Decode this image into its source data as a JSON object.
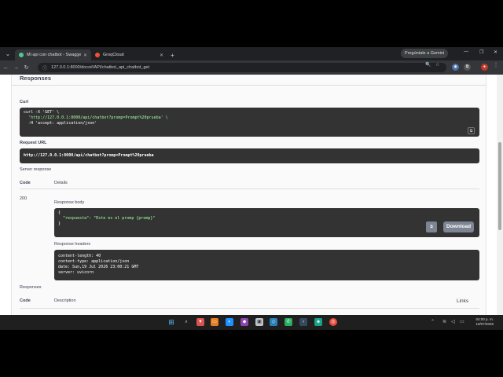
{
  "browser": {
    "tabs": [
      {
        "label": "Mi api con chatbot - Swagger",
        "favicon_color": "#49cc90",
        "active": true
      },
      {
        "label": "GroqCloud",
        "favicon_color": "#f55036",
        "active": false
      }
    ],
    "new_tab": "+",
    "gemini_button": "Pregúntale a Gemini",
    "url": "127.0.0.1:8000/docs#/API/chatbot_api_chatbot_get"
  },
  "page": {
    "responses_heading_top": "Responses",
    "curl_label": "Curl",
    "curl_lines": [
      "curl -X 'GET' \\",
      "  'http://127.0.0.1:8000/api/chatbot?promp=Prompt%20prueba' \\",
      "  -H 'accept: application/json'"
    ],
    "request_url_label": "Request URL",
    "request_url": "http://127.0.0.1:8000/api/chatbot?promp=Prompt%20prueba",
    "server_response_label": "Server response",
    "code_header": "Code",
    "details_header": "Details",
    "status_code": "200",
    "response_body_label": "Response body",
    "response_body_lines": [
      "{",
      "  \"respuesta\": \"Este es el promp {promp}\"",
      "}"
    ],
    "download_button": "Download",
    "response_headers_label": "Response headers",
    "response_headers_lines": [
      "content-length: 40",
      "content-type: application/json",
      "date: Sun,19 Jul 2026 23:00:21 GMT",
      "server: uvicorn"
    ],
    "responses_heading_bottom": "Responses",
    "code_header_2": "Code",
    "description_header": "Description",
    "links_header": "Links"
  },
  "taskbar": {
    "time": "04:00 p. m.",
    "date": "19/07/2026"
  },
  "colors": {
    "code_bg": "#333333",
    "string": "#a2fca2",
    "taskbar": "#1f1f1f"
  }
}
